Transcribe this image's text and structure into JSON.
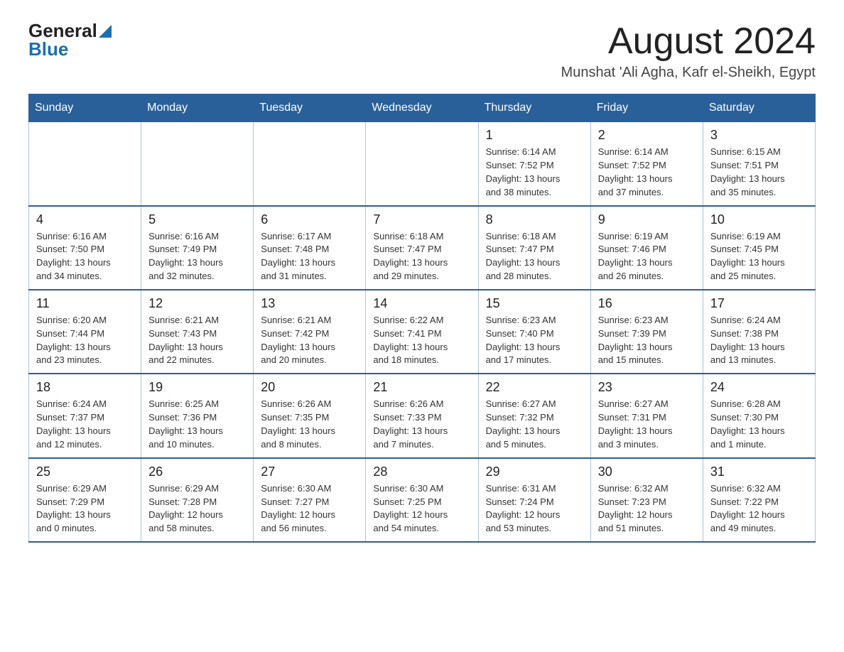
{
  "header": {
    "logo_general": "General",
    "logo_blue": "Blue",
    "month_title": "August 2024",
    "location": "Munshat 'Ali Agha, Kafr el-Sheikh, Egypt"
  },
  "calendar": {
    "days_of_week": [
      "Sunday",
      "Monday",
      "Tuesday",
      "Wednesday",
      "Thursday",
      "Friday",
      "Saturday"
    ],
    "weeks": [
      {
        "days": [
          {
            "number": "",
            "info": ""
          },
          {
            "number": "",
            "info": ""
          },
          {
            "number": "",
            "info": ""
          },
          {
            "number": "",
            "info": ""
          },
          {
            "number": "1",
            "info": "Sunrise: 6:14 AM\nSunset: 7:52 PM\nDaylight: 13 hours\nand 38 minutes."
          },
          {
            "number": "2",
            "info": "Sunrise: 6:14 AM\nSunset: 7:52 PM\nDaylight: 13 hours\nand 37 minutes."
          },
          {
            "number": "3",
            "info": "Sunrise: 6:15 AM\nSunset: 7:51 PM\nDaylight: 13 hours\nand 35 minutes."
          }
        ]
      },
      {
        "days": [
          {
            "number": "4",
            "info": "Sunrise: 6:16 AM\nSunset: 7:50 PM\nDaylight: 13 hours\nand 34 minutes."
          },
          {
            "number": "5",
            "info": "Sunrise: 6:16 AM\nSunset: 7:49 PM\nDaylight: 13 hours\nand 32 minutes."
          },
          {
            "number": "6",
            "info": "Sunrise: 6:17 AM\nSunset: 7:48 PM\nDaylight: 13 hours\nand 31 minutes."
          },
          {
            "number": "7",
            "info": "Sunrise: 6:18 AM\nSunset: 7:47 PM\nDaylight: 13 hours\nand 29 minutes."
          },
          {
            "number": "8",
            "info": "Sunrise: 6:18 AM\nSunset: 7:47 PM\nDaylight: 13 hours\nand 28 minutes."
          },
          {
            "number": "9",
            "info": "Sunrise: 6:19 AM\nSunset: 7:46 PM\nDaylight: 13 hours\nand 26 minutes."
          },
          {
            "number": "10",
            "info": "Sunrise: 6:19 AM\nSunset: 7:45 PM\nDaylight: 13 hours\nand 25 minutes."
          }
        ]
      },
      {
        "days": [
          {
            "number": "11",
            "info": "Sunrise: 6:20 AM\nSunset: 7:44 PM\nDaylight: 13 hours\nand 23 minutes."
          },
          {
            "number": "12",
            "info": "Sunrise: 6:21 AM\nSunset: 7:43 PM\nDaylight: 13 hours\nand 22 minutes."
          },
          {
            "number": "13",
            "info": "Sunrise: 6:21 AM\nSunset: 7:42 PM\nDaylight: 13 hours\nand 20 minutes."
          },
          {
            "number": "14",
            "info": "Sunrise: 6:22 AM\nSunset: 7:41 PM\nDaylight: 13 hours\nand 18 minutes."
          },
          {
            "number": "15",
            "info": "Sunrise: 6:23 AM\nSunset: 7:40 PM\nDaylight: 13 hours\nand 17 minutes."
          },
          {
            "number": "16",
            "info": "Sunrise: 6:23 AM\nSunset: 7:39 PM\nDaylight: 13 hours\nand 15 minutes."
          },
          {
            "number": "17",
            "info": "Sunrise: 6:24 AM\nSunset: 7:38 PM\nDaylight: 13 hours\nand 13 minutes."
          }
        ]
      },
      {
        "days": [
          {
            "number": "18",
            "info": "Sunrise: 6:24 AM\nSunset: 7:37 PM\nDaylight: 13 hours\nand 12 minutes."
          },
          {
            "number": "19",
            "info": "Sunrise: 6:25 AM\nSunset: 7:36 PM\nDaylight: 13 hours\nand 10 minutes."
          },
          {
            "number": "20",
            "info": "Sunrise: 6:26 AM\nSunset: 7:35 PM\nDaylight: 13 hours\nand 8 minutes."
          },
          {
            "number": "21",
            "info": "Sunrise: 6:26 AM\nSunset: 7:33 PM\nDaylight: 13 hours\nand 7 minutes."
          },
          {
            "number": "22",
            "info": "Sunrise: 6:27 AM\nSunset: 7:32 PM\nDaylight: 13 hours\nand 5 minutes."
          },
          {
            "number": "23",
            "info": "Sunrise: 6:27 AM\nSunset: 7:31 PM\nDaylight: 13 hours\nand 3 minutes."
          },
          {
            "number": "24",
            "info": "Sunrise: 6:28 AM\nSunset: 7:30 PM\nDaylight: 13 hours\nand 1 minute."
          }
        ]
      },
      {
        "days": [
          {
            "number": "25",
            "info": "Sunrise: 6:29 AM\nSunset: 7:29 PM\nDaylight: 13 hours\nand 0 minutes."
          },
          {
            "number": "26",
            "info": "Sunrise: 6:29 AM\nSunset: 7:28 PM\nDaylight: 12 hours\nand 58 minutes."
          },
          {
            "number": "27",
            "info": "Sunrise: 6:30 AM\nSunset: 7:27 PM\nDaylight: 12 hours\nand 56 minutes."
          },
          {
            "number": "28",
            "info": "Sunrise: 6:30 AM\nSunset: 7:25 PM\nDaylight: 12 hours\nand 54 minutes."
          },
          {
            "number": "29",
            "info": "Sunrise: 6:31 AM\nSunset: 7:24 PM\nDaylight: 12 hours\nand 53 minutes."
          },
          {
            "number": "30",
            "info": "Sunrise: 6:32 AM\nSunset: 7:23 PM\nDaylight: 12 hours\nand 51 minutes."
          },
          {
            "number": "31",
            "info": "Sunrise: 6:32 AM\nSunset: 7:22 PM\nDaylight: 12 hours\nand 49 minutes."
          }
        ]
      }
    ]
  }
}
